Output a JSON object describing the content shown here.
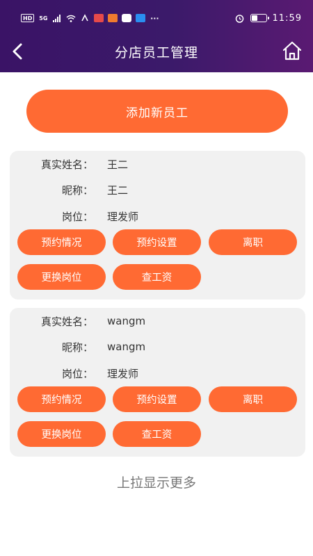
{
  "status_bar": {
    "left_icons": [
      "hd-icon",
      "signal-5g-icon",
      "signal-bars-icon",
      "wifi-icon",
      "vpn-icon",
      "app-notification-icon",
      "app-notification-icon",
      "app-notification-icon",
      "app-notification-icon",
      "more-icon"
    ],
    "hd_label": "HD",
    "net_label": "5G",
    "more_label": "···",
    "time": "11:59"
  },
  "header": {
    "title": "分店员工管理"
  },
  "actions": {
    "add_label": "添加新员工"
  },
  "employees": [
    {
      "name_label": "真实姓名：",
      "name": "王二",
      "nickname_label": "昵称：",
      "nickname": "王二",
      "position_label": "岗位：",
      "position": "理发师",
      "buttons": [
        "预约情况",
        "预约设置",
        "离职",
        "更换岗位",
        "查工资"
      ]
    },
    {
      "name_label": "真实姓名：",
      "name": "wangm",
      "nickname_label": "昵称：",
      "nickname": "wangm",
      "position_label": "岗位：",
      "position": "理发师",
      "buttons": [
        "预约情况",
        "预约设置",
        "离职",
        "更换岗位",
        "查工资"
      ]
    }
  ],
  "footer": {
    "load_more": "上拉显示更多"
  },
  "colors": {
    "header_gradient_start": "#3a1366",
    "header_gradient_end": "#5a1a72",
    "accent": "#ff6a33",
    "card_bg": "#f1f1f1"
  }
}
